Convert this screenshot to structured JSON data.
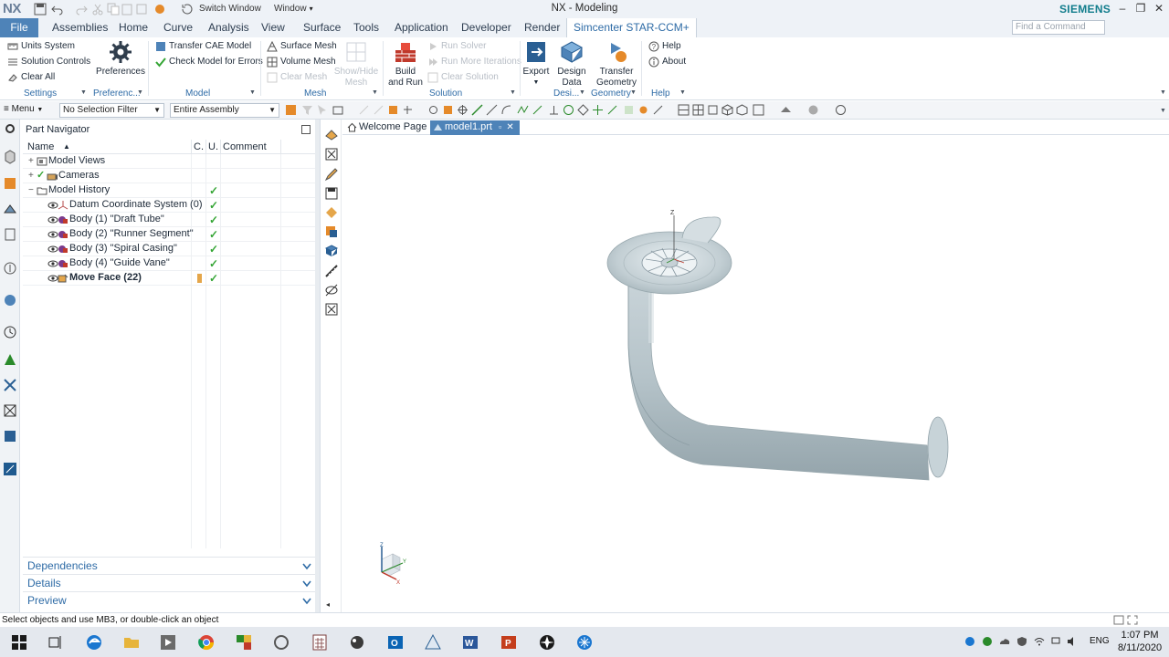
{
  "window": {
    "app_logo": "NX",
    "title": "NX - Modeling",
    "brand": "SIEMENS",
    "quick_access": {
      "switch_window": "Switch Window",
      "window_menu": "Window"
    },
    "command_search_placeholder": "Find a Command"
  },
  "menu_tabs": [
    {
      "label": "File"
    },
    {
      "label": "Assemblies"
    },
    {
      "label": "Home"
    },
    {
      "label": "Curve"
    },
    {
      "label": "Analysis"
    },
    {
      "label": "View"
    },
    {
      "label": "Surface"
    },
    {
      "label": "Tools"
    },
    {
      "label": "Application"
    },
    {
      "label": "Developer"
    },
    {
      "label": "Render"
    },
    {
      "label": "Simcenter STAR-CCM+"
    }
  ],
  "ribbon": {
    "settings": {
      "units_system": "Units System",
      "solution_controls": "Solution Controls",
      "clear_all": "Clear All",
      "group": "Settings"
    },
    "preferences": {
      "label": "Preferences",
      "group": "Preferenc..."
    },
    "model": {
      "transfer_cae": "Transfer CAE Model",
      "check_errors": "Check Model for Errors",
      "group": "Model"
    },
    "mesh": {
      "surface_mesh": "Surface Mesh",
      "volume_mesh": "Volume Mesh",
      "clear_mesh": "Clear Mesh",
      "show_hide_mesh": "Show/Hide Mesh",
      "group": "Mesh"
    },
    "solution": {
      "build_and_run": "Build and Run",
      "run_solver": "Run Solver",
      "run_more_iterations": "Run More Iterations",
      "clear_solution": "Clear Solution",
      "group": "Solution"
    },
    "export": {
      "label": "Export"
    },
    "design": {
      "label": "Design Data",
      "group": "Desi..."
    },
    "geometry": {
      "label": "Transfer Geometry",
      "group": "Geometry"
    },
    "help": {
      "help": "Help",
      "about": "About",
      "group": "Help"
    }
  },
  "selection_bar": {
    "menu": "Menu",
    "filter": "No Selection Filter",
    "scope": "Entire Assembly"
  },
  "part_navigator": {
    "title": "Part Navigator",
    "columns": {
      "name": "Name",
      "c": "C.",
      "u": "U.",
      "comment": "Comment"
    },
    "rows": [
      {
        "label": "Model Views"
      },
      {
        "label": "Cameras"
      },
      {
        "label": "Model History"
      },
      {
        "label": "Datum Coordinate System (0)"
      },
      {
        "label": "Body (1) \"Draft Tube\""
      },
      {
        "label": "Body (2) \"Runner Segment\""
      },
      {
        "label": "Body (3) \"Spiral Casing\""
      },
      {
        "label": "Body (4) \"Guide Vane\""
      },
      {
        "label": "Move Face (22)"
      }
    ],
    "panels": {
      "dependencies": "Dependencies",
      "details": "Details",
      "preview": "Preview"
    }
  },
  "doc_tabs": {
    "welcome": "Welcome Page",
    "model": "model1.prt"
  },
  "status_bar": {
    "message": "Select objects and use MB3, or double-click an object"
  },
  "taskbar": {
    "language": "ENG",
    "time": "1:07 PM",
    "date": "8/11/2020"
  },
  "colors": {
    "accent": "#4e83b8",
    "brand": "#117d8c",
    "check": "#34a534",
    "model_fill": "#b9c6cc"
  }
}
